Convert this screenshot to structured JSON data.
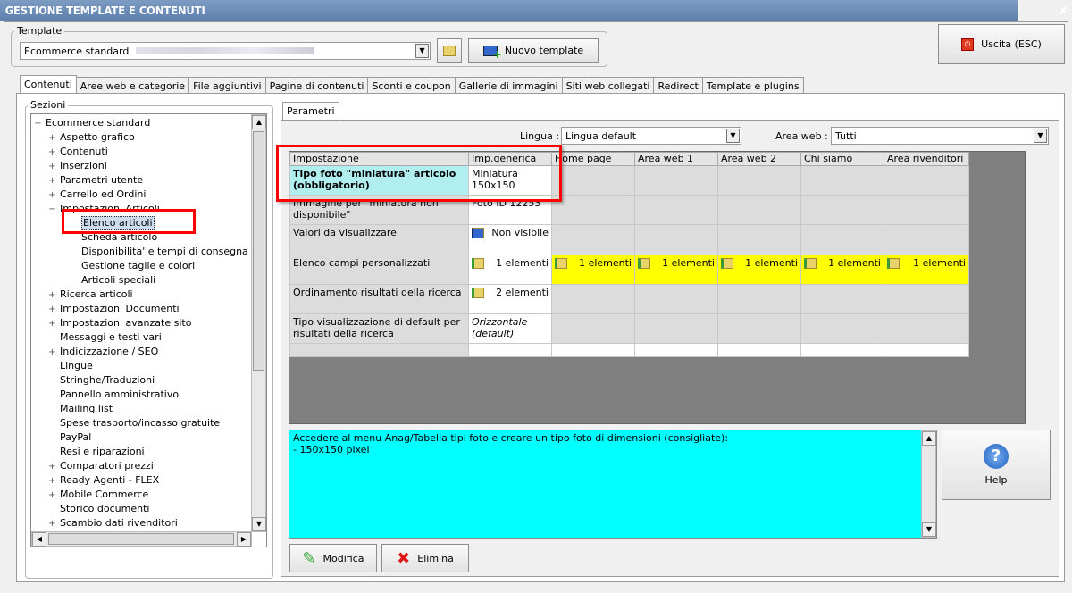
{
  "window": {
    "title": "GESTIONE TEMPLATE E CONTENUTI",
    "close": "x"
  },
  "template": {
    "label": "Template",
    "value": "Ecommerce standard",
    "new_button": "Nuovo template"
  },
  "exit_button": "Uscita (ESC)",
  "tabs": [
    "Contenuti",
    "Aree web e categorie",
    "File aggiuntivi",
    "Pagine di contenuti",
    "Sconti e coupon",
    "Gallerie di immagini",
    "Siti web collegati",
    "Redirect",
    "Template e plugins"
  ],
  "sections": {
    "label": "Sezioni",
    "tree": [
      {
        "t": "Ecommerce standard",
        "pm": "−",
        "lvl": 0
      },
      {
        "t": "Aspetto grafico",
        "pm": "+",
        "lvl": 1
      },
      {
        "t": "Contenuti",
        "pm": "+",
        "lvl": 1
      },
      {
        "t": "Inserzioni",
        "pm": "+",
        "lvl": 1
      },
      {
        "t": "Parametri utente",
        "pm": "+",
        "lvl": 1
      },
      {
        "t": "Carrello ed Ordini",
        "pm": "+",
        "lvl": 1
      },
      {
        "t": "Impostazioni Articoli",
        "pm": "−",
        "lvl": 1
      },
      {
        "t": "Elenco articoli",
        "pm": "",
        "lvl": 2,
        "sel": true
      },
      {
        "t": "Scheda articolo",
        "pm": "",
        "lvl": 2
      },
      {
        "t": "Disponibilita' e tempi di consegna",
        "pm": "",
        "lvl": 2
      },
      {
        "t": "Gestione taglie e colori",
        "pm": "",
        "lvl": 2
      },
      {
        "t": "Articoli speciali",
        "pm": "",
        "lvl": 2
      },
      {
        "t": "Ricerca articoli",
        "pm": "+",
        "lvl": 1
      },
      {
        "t": "Impostazioni Documenti",
        "pm": "+",
        "lvl": 1
      },
      {
        "t": "Impostazioni avanzate sito",
        "pm": "+",
        "lvl": 1
      },
      {
        "t": "Messaggi e testi vari",
        "pm": "",
        "lvl": 1
      },
      {
        "t": "Indicizzazione / SEO",
        "pm": "+",
        "lvl": 1
      },
      {
        "t": "Lingue",
        "pm": "",
        "lvl": 1
      },
      {
        "t": "Stringhe/Traduzioni",
        "pm": "",
        "lvl": 1
      },
      {
        "t": "Pannello amministrativo",
        "pm": "",
        "lvl": 1
      },
      {
        "t": "Mailing list",
        "pm": "",
        "lvl": 1
      },
      {
        "t": "Spese trasporto/incasso gratuite",
        "pm": "",
        "lvl": 1
      },
      {
        "t": "PayPal",
        "pm": "",
        "lvl": 1
      },
      {
        "t": "Resi e riparazioni",
        "pm": "",
        "lvl": 1
      },
      {
        "t": "Comparatori prezzi",
        "pm": "+",
        "lvl": 1
      },
      {
        "t": "Ready Agenti - FLEX",
        "pm": "+",
        "lvl": 1
      },
      {
        "t": "Mobile Commerce",
        "pm": "+",
        "lvl": 1
      },
      {
        "t": "Storico documenti",
        "pm": "",
        "lvl": 1
      },
      {
        "t": "Scambio dati rivenditori",
        "pm": "+",
        "lvl": 1
      }
    ]
  },
  "params": {
    "tab": "Parametri",
    "lingua_label": "Lingua :",
    "lingua_value": "Lingua default",
    "area_label": "Area web :",
    "area_value": "Tutti"
  },
  "grid": {
    "headers": [
      "Impostazione",
      "Imp.generica",
      "Home page",
      "Area web 1",
      "Area web 2",
      "Chi siamo",
      "Area rivenditori"
    ],
    "rows": [
      {
        "name": "Tipo foto \"miniatura\" articolo (obbligatorio)",
        "generic": "Miniatura 150x150"
      },
      {
        "name": "Immagine per \"miniatura non disponibile\"",
        "generic": "Foto ID 12253"
      },
      {
        "name": "Valori da visualizzare",
        "generic": "Non visibile"
      },
      {
        "name": "Elenco campi personalizzati",
        "generic": "1 elementi",
        "areas": [
          "1 elementi",
          "1 elementi",
          "1 elementi",
          "1 elementi",
          "1 elementi"
        ]
      },
      {
        "name": "Ordinamento risultati della ricerca",
        "generic": "2 elementi"
      },
      {
        "name": "Tipo visualizzazione di default per risultati della ricerca",
        "generic": "Orizzontale (default)"
      }
    ]
  },
  "help_text": "Accedere al menu Anag/Tabella tipi foto e creare un tipo foto di dimensioni (consigliate):\n- 150x150 pixel",
  "help_button": "Help",
  "buttons": {
    "modify": "Modifica",
    "delete": "Elimina"
  },
  "colors": {
    "highlight": "#ff0000",
    "yellow": "#ffff00",
    "help_bg": "#00ffff",
    "selected_row": "#b0eef0"
  }
}
